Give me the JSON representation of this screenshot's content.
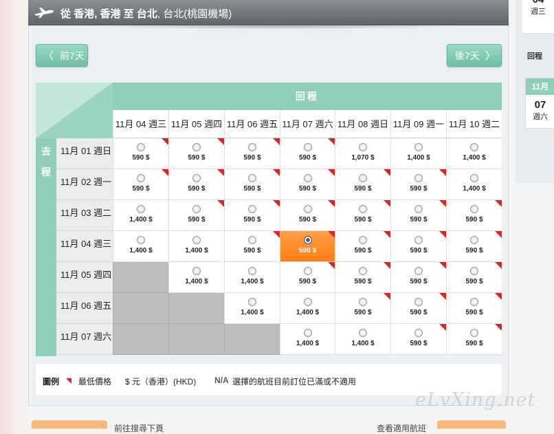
{
  "header": {
    "from_word": "從",
    "origin": "香港, 香港",
    "to_word": "至",
    "destination_city": "台北",
    "destination_detail": ", 台北(桃園機場)"
  },
  "nav": {
    "prev_label": "前7天",
    "next_label": "後7天",
    "prev_chevron": "〈",
    "next_chevron": "〉"
  },
  "grid": {
    "return_label": "回程",
    "departure_label_chars": [
      "去",
      "程"
    ],
    "return_dates": [
      "11月 04 週三",
      "11月 05 週四",
      "11月 06 週五",
      "11月 07 週六",
      "11月 08 週日",
      "11月 09 週一",
      "11月 10 週二"
    ],
    "rows": [
      {
        "date": "11月 01 週日",
        "cells": [
          {
            "price": "590 $",
            "flag": true
          },
          {
            "price": "590 $",
            "flag": true
          },
          {
            "price": "590 $",
            "flag": true
          },
          {
            "price": "590 $",
            "flag": true
          },
          {
            "price": "1,070 $",
            "flag": false
          },
          {
            "price": "1,400 $",
            "flag": false
          },
          {
            "price": "1,400 $",
            "flag": false
          }
        ]
      },
      {
        "date": "11月 02 週一",
        "cells": [
          {
            "price": "590 $",
            "flag": true
          },
          {
            "price": "590 $",
            "flag": true
          },
          {
            "price": "590 $",
            "flag": true
          },
          {
            "price": "590 $",
            "flag": true
          },
          {
            "price": "590 $",
            "flag": true
          },
          {
            "price": "590 $",
            "flag": true
          },
          {
            "price": "1,400 $",
            "flag": false
          }
        ]
      },
      {
        "date": "11月 03 週二",
        "cells": [
          {
            "price": "1,400 $",
            "flag": false
          },
          {
            "price": "590 $",
            "flag": true
          },
          {
            "price": "590 $",
            "flag": true
          },
          {
            "price": "590 $",
            "flag": true
          },
          {
            "price": "590 $",
            "flag": true
          },
          {
            "price": "590 $",
            "flag": true
          },
          {
            "price": "590 $",
            "flag": true
          }
        ]
      },
      {
        "date": "11月 04 週三",
        "cells": [
          {
            "price": "1,400 $",
            "flag": false
          },
          {
            "price": "1,400 $",
            "flag": false
          },
          {
            "price": "590 $",
            "flag": true
          },
          {
            "price": "590 $",
            "flag": true,
            "selected": true
          },
          {
            "price": "590 $",
            "flag": true
          },
          {
            "price": "590 $",
            "flag": true
          },
          {
            "price": "590 $",
            "flag": true
          }
        ]
      },
      {
        "date": "11月 05 週四",
        "cells": [
          {
            "na": true
          },
          {
            "price": "1,400 $",
            "flag": false
          },
          {
            "price": "1,400 $",
            "flag": false
          },
          {
            "price": "590 $",
            "flag": true
          },
          {
            "price": "590 $",
            "flag": true
          },
          {
            "price": "590 $",
            "flag": true
          },
          {
            "price": "590 $",
            "flag": true
          }
        ]
      },
      {
        "date": "11月 06 週五",
        "cells": [
          {
            "na": true
          },
          {
            "na": true
          },
          {
            "price": "1,400 $",
            "flag": false
          },
          {
            "price": "1,400 $",
            "flag": false
          },
          {
            "price": "590 $",
            "flag": true
          },
          {
            "price": "590 $",
            "flag": true
          },
          {
            "price": "590 $",
            "flag": true
          }
        ]
      },
      {
        "date": "11月 07 週六",
        "cells": [
          {
            "na": true
          },
          {
            "na": true
          },
          {
            "na": true
          },
          {
            "price": "1,400 $",
            "flag": false
          },
          {
            "price": "1,400 $",
            "flag": false
          },
          {
            "price": "590 $",
            "flag": true
          },
          {
            "price": "590 $",
            "flag": true
          }
        ]
      }
    ]
  },
  "legend": {
    "title": "圖例",
    "lowest_price": "最低價格",
    "currency": "$ 元（香港）(HKD)",
    "na_code": "N/A",
    "na_text": "選擇的航班目前訂位已滿或不適用"
  },
  "side": {
    "top_date": "04",
    "top_weekday": "週三",
    "return_label": "回程",
    "card_month": "11月",
    "card_day": "07",
    "card_weekday": "週六"
  },
  "bottom": {
    "left_text": "前往搜尋下頁",
    "right_text": "查看適用航班"
  },
  "watermark": "eLvXing.net",
  "colors": {
    "accent_green": "#8fcfb9",
    "selected_orange": "#ff8a22",
    "flag_red": "#e32222",
    "header_gray": "#6a7075"
  }
}
